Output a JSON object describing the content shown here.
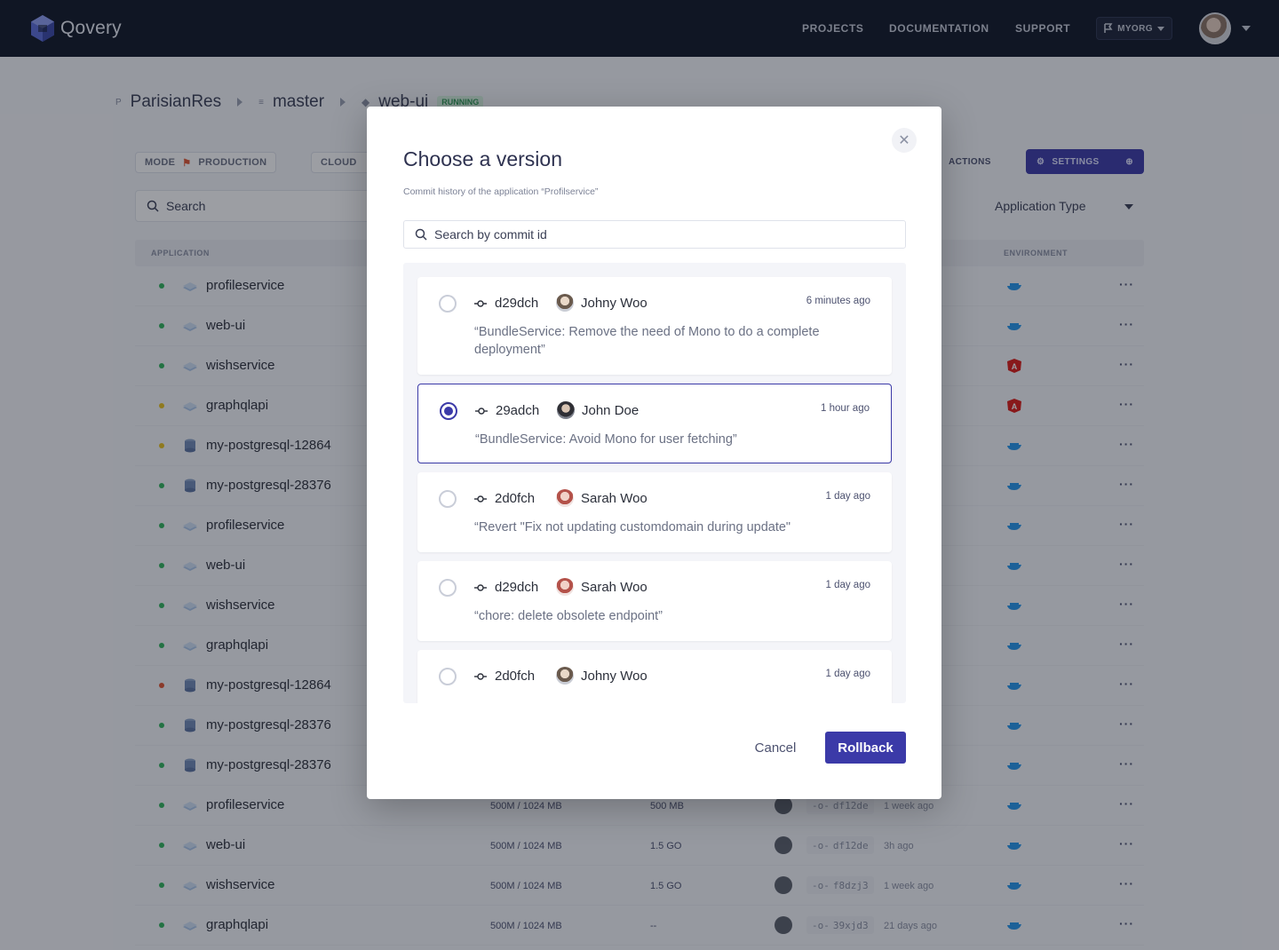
{
  "nav": {
    "logo_text": "Qovery",
    "links": [
      "PROJECTS",
      "DOCUMENTATION",
      "SUPPORT"
    ],
    "org_label": "MYORG"
  },
  "breadcrumb": {
    "project": "ParisianRes",
    "branch": "master",
    "app": "web-ui",
    "status": "RUNNING"
  },
  "toolbar": {
    "mode_label": "MODE",
    "mode_value": "PRODUCTION",
    "cloud_label": "CLOUD",
    "actions_label": "ACTIONS",
    "settings_label": "SETTINGS"
  },
  "filters": {
    "search_label": "Search",
    "app_type_label": "Application Type"
  },
  "table": {
    "col_application": "APPLICATION",
    "col_environment": "ENVIRONMENT",
    "rows": [
      {
        "name": "profileservice",
        "status": "#2fb35a",
        "type": "app",
        "env": "docker"
      },
      {
        "name": "web-ui",
        "status": "#2fb35a",
        "type": "app",
        "env": "docker"
      },
      {
        "name": "wishservice",
        "status": "#2fb35a",
        "type": "app",
        "env": "angular"
      },
      {
        "name": "graphqlapi",
        "status": "#e8c21c",
        "type": "app",
        "env": "angular"
      },
      {
        "name": "my-postgresql-12864",
        "status": "#e8c21c",
        "type": "db",
        "env": "docker"
      },
      {
        "name": "my-postgresql-28376",
        "status": "#2fb35a",
        "type": "db",
        "env": "docker"
      },
      {
        "name": "profileservice",
        "status": "#2fb35a",
        "type": "app",
        "env": "docker"
      },
      {
        "name": "web-ui",
        "status": "#2fb35a",
        "type": "app",
        "env": "docker"
      },
      {
        "name": "wishservice",
        "status": "#2fb35a",
        "type": "app",
        "env": "docker"
      },
      {
        "name": "graphqlapi",
        "status": "#2fb35a",
        "type": "app",
        "env": "docker"
      },
      {
        "name": "my-postgresql-12864",
        "status": "#e0542f",
        "type": "db",
        "env": "docker"
      },
      {
        "name": "my-postgresql-28376",
        "status": "#2fb35a",
        "type": "db",
        "env": "docker"
      },
      {
        "name": "my-postgresql-28376",
        "status": "#2fb35a",
        "type": "db",
        "env": "docker"
      },
      {
        "name": "profileservice",
        "status": "#2fb35a",
        "type": "app",
        "env": "docker",
        "memory": "500M / 1024 MB",
        "storage": "500 MB",
        "commit": "df12de",
        "ago": "1 week ago"
      },
      {
        "name": "web-ui",
        "status": "#2fb35a",
        "type": "app",
        "env": "docker",
        "memory": "500M / 1024 MB",
        "storage": "1.5 GO",
        "commit": "df12de",
        "ago": "3h ago"
      },
      {
        "name": "wishservice",
        "status": "#2fb35a",
        "type": "app",
        "env": "docker",
        "memory": "500M / 1024 MB",
        "storage": "1.5 GO",
        "commit": "f8dzj3",
        "ago": "1 week ago"
      },
      {
        "name": "graphqlapi",
        "status": "#2fb35a",
        "type": "app",
        "env": "docker",
        "memory": "500M / 1024 MB",
        "storage": "--",
        "commit": "39xjd3",
        "ago": "21 days ago"
      }
    ]
  },
  "modal": {
    "title": "Choose a version",
    "subtitle": "Commit history of the application “Profilservice”",
    "search_placeholder": "Search by commit id",
    "commits": [
      {
        "id": "d29dch",
        "author": "Johny Woo",
        "time": "6 minutes ago",
        "message": "“BundleService: Remove the need of Mono to do a complete deployment”",
        "selected": false
      },
      {
        "id": "29adch",
        "author": "John Doe",
        "time": "1 hour ago",
        "message": "“BundleService: Avoid Mono for user fetching”",
        "selected": true
      },
      {
        "id": "2d0fch",
        "author": "Sarah Woo",
        "time": "1 day ago",
        "message": "“Revert \"Fix not updating customdomain during update\"",
        "selected": false
      },
      {
        "id": "d29dch",
        "author": "Sarah Woo",
        "time": "1 day ago",
        "message": "“chore: delete obsolete endpoint”",
        "selected": false
      },
      {
        "id": "2d0fch",
        "author": "Johny Woo",
        "time": "1 day ago",
        "message": "",
        "selected": false
      }
    ],
    "cancel_label": "Cancel",
    "rollback_label": "Rollback"
  },
  "colors": {
    "primary": "#3b3aa8",
    "topbar": "#0f1525",
    "docker_blue": "#2496ed",
    "angular_red": "#dd1b16"
  }
}
